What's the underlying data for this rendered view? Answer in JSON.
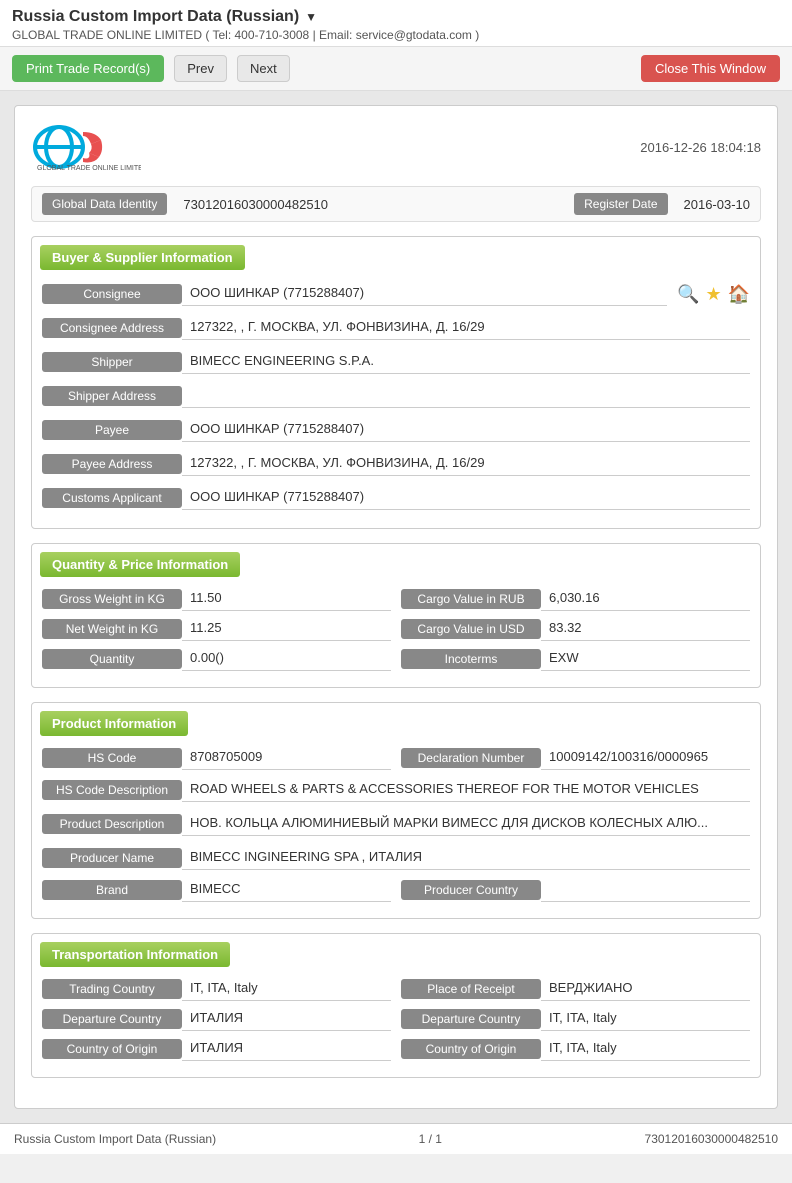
{
  "page": {
    "title": "Russia Custom Import Data (Russian)",
    "subtitle": "GLOBAL TRADE ONLINE LIMITED ( Tel: 400-710-3008 | Email: service@gtodata.com )",
    "datetime": "2016-12-26 18:04:18"
  },
  "toolbar": {
    "print_label": "Print Trade Record(s)",
    "prev_label": "Prev",
    "next_label": "Next",
    "close_label": "Close This Window"
  },
  "identity": {
    "global_data_identity_label": "Global Data Identity",
    "global_data_identity_value": "73012016030000482510",
    "register_date_label": "Register Date",
    "register_date_value": "2016-03-10"
  },
  "buyer_supplier": {
    "section_title": "Buyer & Supplier Information",
    "consignee_label": "Consignee",
    "consignee_value": "ООО ШИНКАР  (7715288407)",
    "consignee_address_label": "Consignee Address",
    "consignee_address_value": "127322, , Г. МОСКВА, УЛ. ФОНВИЗИНА, Д. 16/29",
    "shipper_label": "Shipper",
    "shipper_value": "BIMECC ENGINEERING S.P.A.",
    "shipper_address_label": "Shipper Address",
    "shipper_address_value": "",
    "payee_label": "Payee",
    "payee_value": "ООО ШИНКАР  (7715288407)",
    "payee_address_label": "Payee Address",
    "payee_address_value": "127322, , Г. МОСКВА, УЛ. ФОНВИЗИНА, Д. 16/29",
    "customs_applicant_label": "Customs Applicant",
    "customs_applicant_value": "ООО ШИНКАР  (7715288407)"
  },
  "quantity_price": {
    "section_title": "Quantity & Price Information",
    "gross_weight_label": "Gross Weight in KG",
    "gross_weight_value": "11.50",
    "cargo_value_rub_label": "Cargo Value in RUB",
    "cargo_value_rub_value": "6,030.16",
    "net_weight_label": "Net Weight in KG",
    "net_weight_value": "11.25",
    "cargo_value_usd_label": "Cargo Value in USD",
    "cargo_value_usd_value": "83.32",
    "quantity_label": "Quantity",
    "quantity_value": "0.00()",
    "incoterms_label": "Incoterms",
    "incoterms_value": "EXW"
  },
  "product": {
    "section_title": "Product Information",
    "hs_code_label": "HS Code",
    "hs_code_value": "8708705009",
    "declaration_number_label": "Declaration Number",
    "declaration_number_value": "10009142/100316/0000965",
    "hs_code_description_label": "HS Code Description",
    "hs_code_description_value": "ROAD WHEELS & PARTS & ACCESSORIES THEREOF FOR THE MOTOR VEHICLES",
    "product_description_label": "Product Description",
    "product_description_value": "НОВ. КОЛЬЦА АЛЮМИНИЕВЫЙ МАРКИ ВИМЕСС ДЛЯ ДИСКОВ КОЛЕСНЫХ АЛЮ...",
    "producer_name_label": "Producer Name",
    "producer_name_value": "BIMECC INGINEERING SPA , ИТАЛИЯ",
    "brand_label": "Brand",
    "brand_value": "BIMECC",
    "producer_country_label": "Producer Country",
    "producer_country_value": ""
  },
  "transportation": {
    "section_title": "Transportation Information",
    "trading_country_label": "Trading Country",
    "trading_country_value": "IT, ITA, Italy",
    "place_of_receipt_label": "Place of Receipt",
    "place_of_receipt_value": "ВЕРДЖИАНО",
    "departure_country_left_label": "Departure Country",
    "departure_country_left_value": "ИТАЛИЯ",
    "departure_country_right_label": "Departure Country",
    "departure_country_right_value": "IT, ITA, Italy",
    "country_of_origin_left_label": "Country of Origin",
    "country_of_origin_left_value": "ИТАЛИЯ",
    "country_of_origin_right_label": "Country of Origin",
    "country_of_origin_right_value": "IT, ITA, Italy"
  },
  "footer": {
    "left": "Russia Custom Import Data (Russian)",
    "center": "1 / 1",
    "right": "73012016030000482510"
  }
}
